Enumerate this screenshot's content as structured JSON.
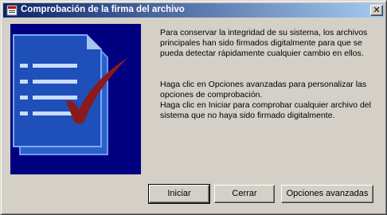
{
  "window": {
    "title": "Comprobación de la firma del archivo",
    "close_glyph": "✕"
  },
  "body": {
    "paragraph1": "Para conservar la integridad de su sistema, los archivos principales han sido firmados digitalmente para que se pueda detectar rápidamente cualquier cambio en ellos.",
    "paragraph2": "Haga clic en Opciones avanzadas para personalizar las opciones de comprobación.",
    "paragraph3": "Haga clic en Iniciar para comprobar cualquier archivo del sistema que no haya sido firmado digitalmente."
  },
  "buttons": {
    "start": "Iniciar",
    "close": "Cerrar",
    "advanced": "Opciones avanzadas"
  },
  "illustration": {
    "icon": "signed-document-checkmark",
    "background": "#000080",
    "page_color": "#3a6ed8",
    "check_color": "#8b1a1a"
  }
}
